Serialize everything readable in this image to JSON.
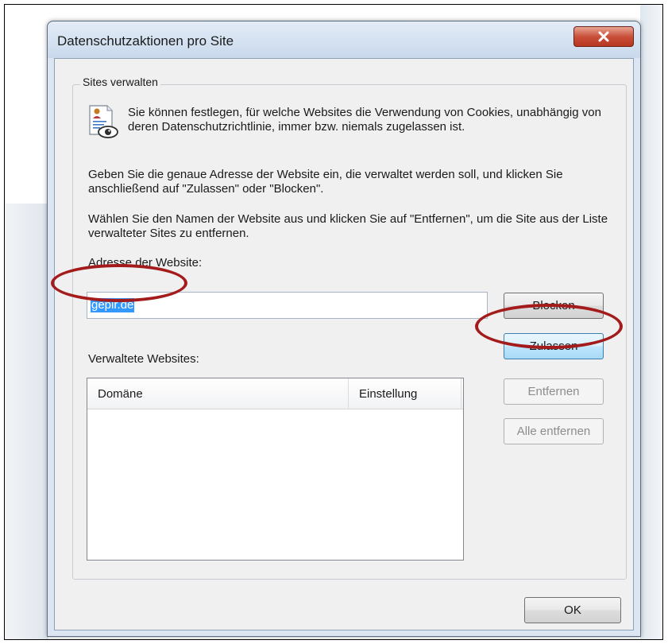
{
  "dialog": {
    "title": "Datenschutzaktionen pro Site",
    "group_label": "Sites verwalten",
    "intro_text": "Sie können festlegen, für welche Websites die Verwendung von Cookies, unabhängig von deren Datenschutzrichtlinie, immer bzw. niemals zugelassen ist.",
    "instruction_1": "Geben Sie die genaue Adresse der Website ein, die verwaltet werden soll, und klicken Sie anschließend auf \"Zulassen\" oder \"Blocken\".",
    "instruction_2": "Wählen Sie den Namen der Website aus und klicken Sie auf \"Entfernen\", um die Site aus der Liste verwalteter Sites zu entfernen.",
    "address_label": "Adresse der Website:",
    "address_value": "gepir.de",
    "block_label": "Blocken",
    "allow_label": "Zulassen",
    "managed_label": "Verwaltete Websites:",
    "list_columns": [
      "Domäne",
      "Einstellung"
    ],
    "list_rows": [],
    "remove_label": "Entfernen",
    "remove_all_label": "Alle entfernen",
    "ok_label": "OK"
  },
  "annotations": {
    "color": "#a31b1b",
    "highlighted": [
      "address-input",
      "allow-button"
    ]
  },
  "icons": {
    "close": "close-icon",
    "privacy": "privacy-document-icon"
  }
}
